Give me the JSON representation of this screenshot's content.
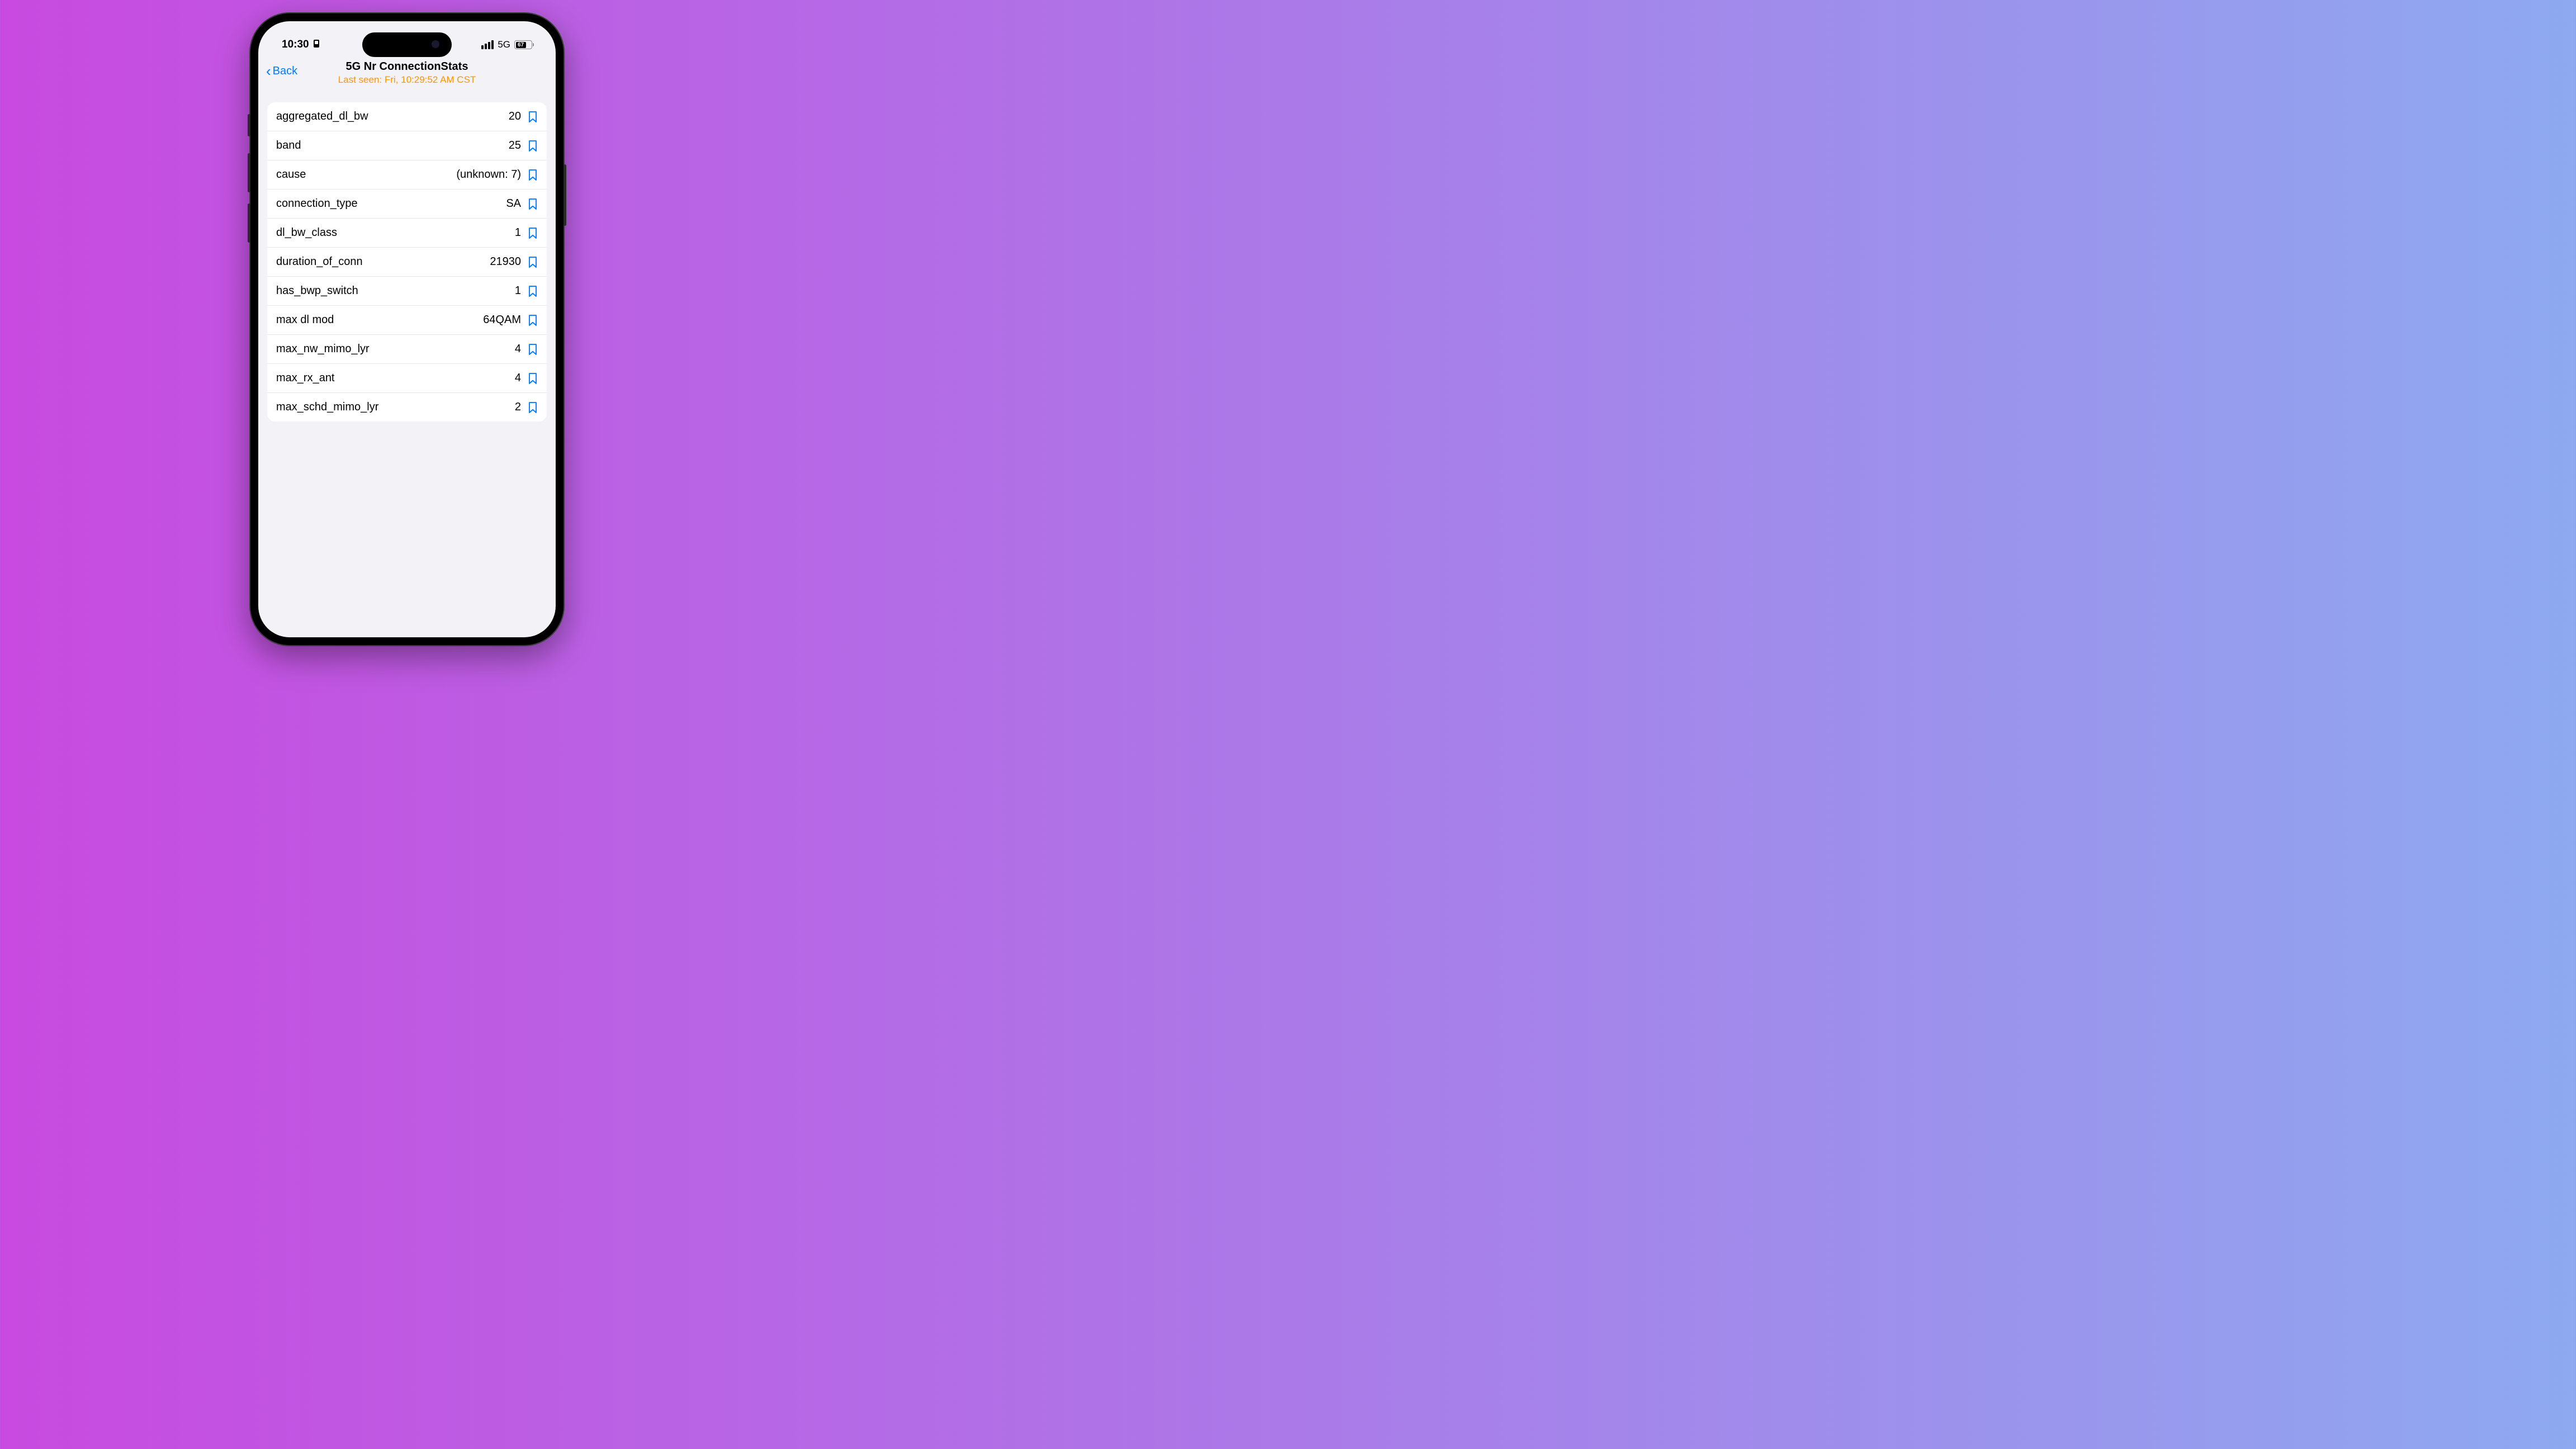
{
  "status": {
    "time": "10:30",
    "network": "5G",
    "battery": "67"
  },
  "nav": {
    "back": "Back",
    "title": "5G Nr ConnectionStats",
    "last_seen": "Last seen: Fri, 10:29:52 AM CST"
  },
  "rows": [
    {
      "key": "aggregated_dl_bw",
      "value": "20"
    },
    {
      "key": "band",
      "value": "25"
    },
    {
      "key": "cause",
      "value": "(unknown: 7)"
    },
    {
      "key": "connection_type",
      "value": "SA"
    },
    {
      "key": "dl_bw_class",
      "value": "1"
    },
    {
      "key": "duration_of_conn",
      "value": "21930"
    },
    {
      "key": "has_bwp_switch",
      "value": "1"
    },
    {
      "key": "max dl mod",
      "value": "64QAM"
    },
    {
      "key": "max_nw_mimo_lyr",
      "value": "4"
    },
    {
      "key": "max_rx_ant",
      "value": "4"
    },
    {
      "key": "max_schd_mimo_lyr",
      "value": "2"
    }
  ]
}
